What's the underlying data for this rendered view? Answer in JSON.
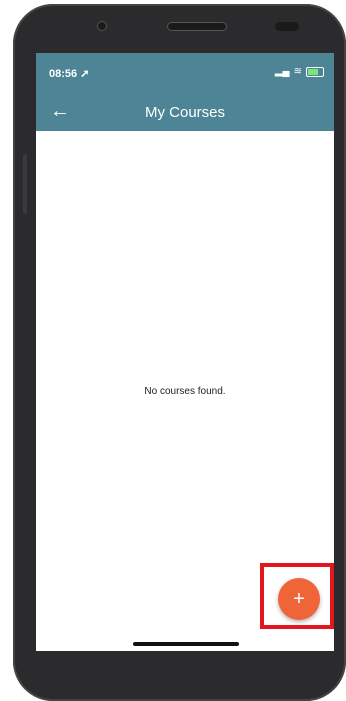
{
  "status_bar": {
    "time": "08:56",
    "location_icon": "location-arrow-icon",
    "signal_icon": "signal-icon",
    "wifi_icon": "wifi-icon",
    "battery_icon": "battery-charging-icon"
  },
  "app_bar": {
    "back_icon": "back-arrow-icon",
    "title": "My Courses"
  },
  "main": {
    "empty_message": "No courses found."
  },
  "fab": {
    "label": "+",
    "icon": "plus-icon"
  },
  "colors": {
    "app_bar": "#4e8596",
    "fab": "#f06537",
    "highlight": "#e3161d"
  }
}
